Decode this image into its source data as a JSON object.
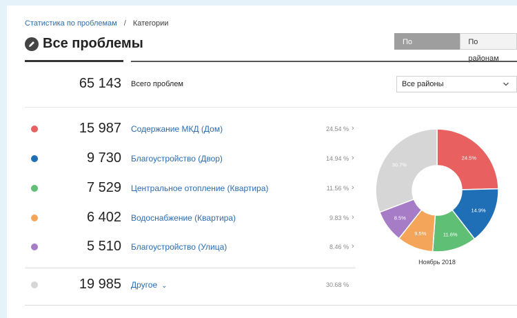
{
  "breadcrumb": {
    "link": "Статистика по проблемам",
    "separator": "/",
    "current": "Категории"
  },
  "header": {
    "title": "Все проблемы",
    "icon": "pencil-icon"
  },
  "view_toggle": {
    "active": "По категориям",
    "inactive": "По районам"
  },
  "summary": {
    "total": "65 143",
    "label": "Всего проблем"
  },
  "district_select": {
    "value": "Все районы",
    "icon": "chevron-down-icon"
  },
  "categories": [
    {
      "count": "15 987",
      "name": "Содержание МКД (Дом)",
      "percent": "24.54 %",
      "color": "#e8605f",
      "arrow": "›"
    },
    {
      "count": "9 730",
      "name": "Благоустройство (Двор)",
      "percent": "14.94 %",
      "color": "#1e6fb5",
      "arrow": "›"
    },
    {
      "count": "7 529",
      "name": "Центральное отопление (Квартира)",
      "percent": "11.56 %",
      "color": "#5fbf74",
      "arrow": "›"
    },
    {
      "count": "6 402",
      "name": "Водоснабжение (Квартира)",
      "percent": "9.83 %",
      "color": "#f4a55a",
      "arrow": "›"
    },
    {
      "count": "5 510",
      "name": "Благоустройство (Улица)",
      "percent": "8.46 %",
      "color": "#a67cc6",
      "arrow": "›"
    }
  ],
  "other": {
    "count": "19 985",
    "name": "Другое",
    "percent": "30.68 %",
    "color": "#d6d6d6",
    "caret": "⌄"
  },
  "chart_data": {
    "type": "pie",
    "categories": [
      "Содержание МКД (Дом)",
      "Благоустройство (Двор)",
      "Центральное отопление (Квартира)",
      "Водоснабжение (Квартира)",
      "Благоустройство (Улица)",
      "Другое"
    ],
    "values": [
      24.5,
      14.9,
      11.6,
      9.5,
      8.5,
      30.7
    ],
    "labels": [
      "24.5%",
      "14.9%",
      "11.6%",
      "9.5%",
      "8.5%",
      "30.7%"
    ],
    "colors": [
      "#e8605f",
      "#1e6fb5",
      "#5fbf74",
      "#f4a55a",
      "#a67cc6",
      "#d6d6d6"
    ],
    "caption": "Ноябрь 2018"
  }
}
